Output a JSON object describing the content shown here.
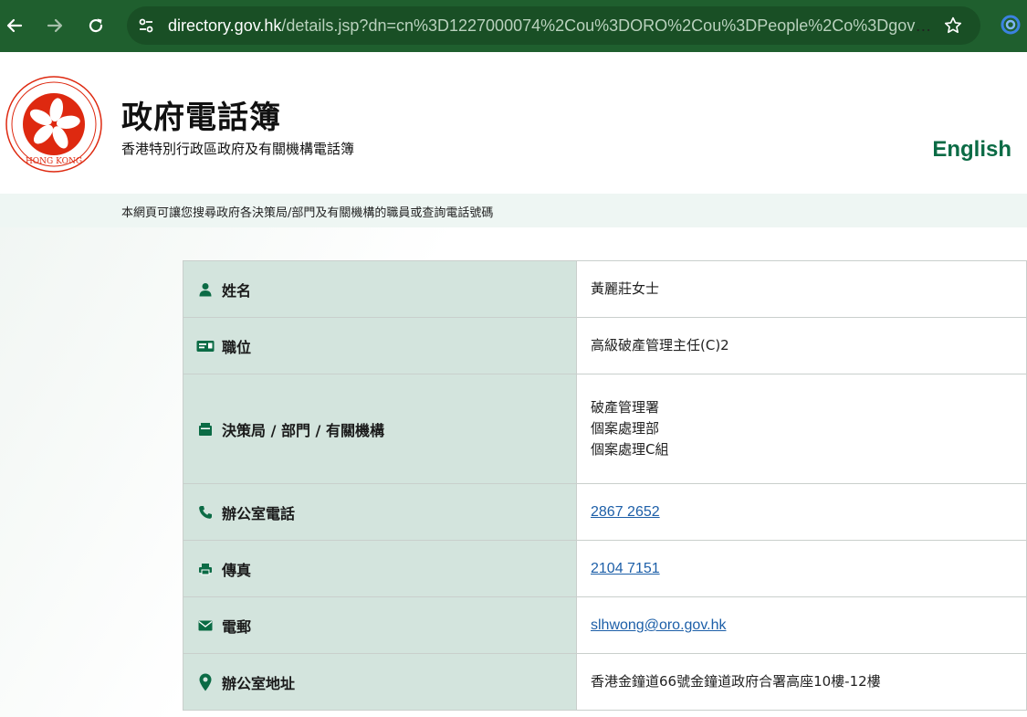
{
  "browser": {
    "url_host": "directory.gov.hk",
    "url_path": "/details.jsp?dn=cn%3D1227000074%2Cou%3DORO%2Cou%3DPeople%2Co%3Dgovernme...",
    "icons": {
      "back": "back-arrow-icon",
      "forward": "forward-arrow-icon",
      "reload": "reload-icon",
      "site_info": "tune-icon",
      "bookmark": "star-icon",
      "extension": "extension-icon"
    }
  },
  "header": {
    "title": "政府電話簿",
    "subtitle": "香港特別行政區政府及有關機構電話簿",
    "language_link": "English",
    "emblem_text": "HONG KONG"
  },
  "notice": "本網頁可讓您搜尋政府各決策局/部門及有關機構的職員或查詢電話號碼",
  "details": {
    "name": {
      "label": "姓名",
      "value": "黃麗莊女士",
      "icon": "person-icon"
    },
    "post": {
      "label": "職位",
      "value": "高級破產管理主任(C)2",
      "icon": "id-card-icon"
    },
    "department": {
      "label": "決策局 / 部門 / 有關機構",
      "lines": [
        "破產管理署",
        "個案處理部",
        "個案處理C組"
      ],
      "icon": "inbox-icon"
    },
    "office_tel": {
      "label": "辦公室電話",
      "value": "2867 2652",
      "icon": "phone-icon"
    },
    "fax": {
      "label": "傳真",
      "value": "2104 7151",
      "icon": "fax-icon"
    },
    "email": {
      "label": "電郵",
      "value": "slhwong@oro.gov.hk",
      "icon": "envelope-icon"
    },
    "address": {
      "label": "辦公室地址",
      "value": "香港金鐘道66號金鐘道政府合署高座10樓-12樓",
      "icon": "map-pin-icon"
    }
  },
  "colors": {
    "chrome_bg": "#1f5f2e",
    "label_bg": "#d3e4dd",
    "icon_green": "#0b6b45",
    "link_blue": "#1d5fa8",
    "emblem_red": "#de2910"
  }
}
